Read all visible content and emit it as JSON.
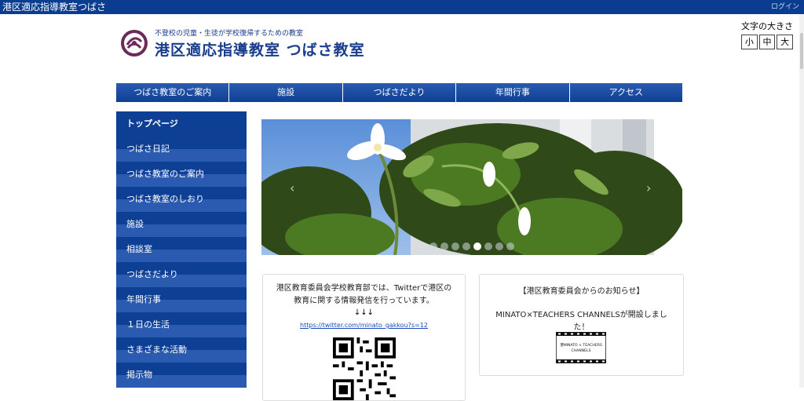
{
  "header": {
    "site_name": "港区適応指導教室つばさ",
    "login_label": "ログイン"
  },
  "logo": {
    "tagline": "不登校の児童・生徒が学校復帰するための教室",
    "title": "港区適応指導教室 つばさ教室"
  },
  "font_size": {
    "label": "文字の大きさ",
    "small": "小",
    "medium": "中",
    "large": "大"
  },
  "global_nav": [
    {
      "label": "つばさ教室のご案内"
    },
    {
      "label": "施設"
    },
    {
      "label": "つばさだより"
    },
    {
      "label": "年間行事"
    },
    {
      "label": "アクセス"
    }
  ],
  "sidebar": {
    "items": [
      {
        "label": "トップページ"
      },
      {
        "label": "つばさ日記"
      },
      {
        "label": "つばさ教室のご案内"
      },
      {
        "label": "つばさ教室のしおり"
      },
      {
        "label": "施設"
      },
      {
        "label": "相談室"
      },
      {
        "label": "つばさだより"
      },
      {
        "label": "年間行事"
      },
      {
        "label": "１日の生活"
      },
      {
        "label": "さまざまな活動"
      },
      {
        "label": "掲示物"
      }
    ]
  },
  "carousel": {
    "slide_count": 8,
    "active_index": 4,
    "prev_icon": "chevron-left-icon",
    "next_icon": "chevron-right-icon"
  },
  "twitter_box": {
    "text": "港区教育委員会学校教育部では、Twitterで港区の教育に関する情報発信を行っています。",
    "arrows": "↓↓↓",
    "link": "https://twitter.com/minato_gakkou?s=12"
  },
  "notice_box": {
    "heading": "【港区教育委員会からのお知らせ】",
    "text": "MINATO×TEACHERS CHANNELSが開設しました！",
    "banner_line1": "港MINATO × TEACHERS",
    "banner_line2": "CHANNELS"
  },
  "colors": {
    "brand": "#0a3d8f",
    "nav": "#0d3f95",
    "link": "#1a4cc0"
  }
}
